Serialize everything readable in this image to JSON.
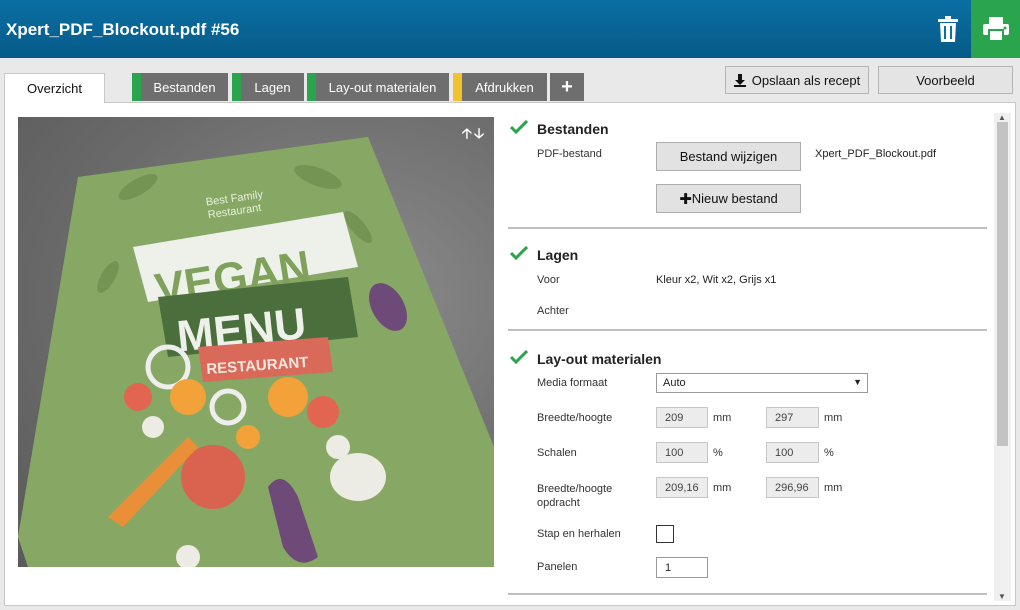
{
  "header": {
    "title": "Xpert_PDF_Blockout.pdf #56"
  },
  "tabs": {
    "overview": "Overzicht",
    "files": "Bestanden",
    "layers": "Lagen",
    "layout": "Lay-out materialen",
    "print": "Afdrukken",
    "add": "+",
    "marker_colors": {
      "files": "#2aa54d",
      "layers": "#2aa54d",
      "layout": "#2aa54d",
      "print": "#f2c12e"
    }
  },
  "toolbar": {
    "save_recipe": "Opslaan als recept",
    "preview": "Voorbeeld"
  },
  "preview_image": {
    "line1": "Best Family",
    "line2": "Restaurant",
    "title1": "VEGAN",
    "title2": "MENU",
    "subtitle": "RESTAURANT"
  },
  "sections": {
    "files": {
      "title": "Bestanden",
      "pdf_label": "PDF-bestand",
      "change_button": "Bestand wijzigen",
      "file_name": "Xpert_PDF_Blockout.pdf",
      "new_button": "Nieuw bestand"
    },
    "layers": {
      "title": "Lagen",
      "front_label": "Voor",
      "front_value": "Kleur x2, Wit x2, Grijs x1",
      "back_label": "Achter"
    },
    "layout": {
      "title": "Lay-out materialen",
      "media_label": "Media formaat",
      "media_value": "Auto",
      "size_label": "Breedte/hoogte",
      "width": "209",
      "height": "297",
      "unit_mm": "mm",
      "scale_label": "Schalen",
      "scale_x": "100",
      "scale_y": "100",
      "unit_pct": "%",
      "job_size_label": "Breedte/hoogte opdracht",
      "job_width": "209,16",
      "job_height": "296,96",
      "step_label": "Stap en herhalen",
      "panels_label": "Panelen",
      "panels_value": "1"
    }
  },
  "colors": {
    "header": "#0b6fa3",
    "print_button": "#2aa54d",
    "check": "#2aa54d"
  }
}
